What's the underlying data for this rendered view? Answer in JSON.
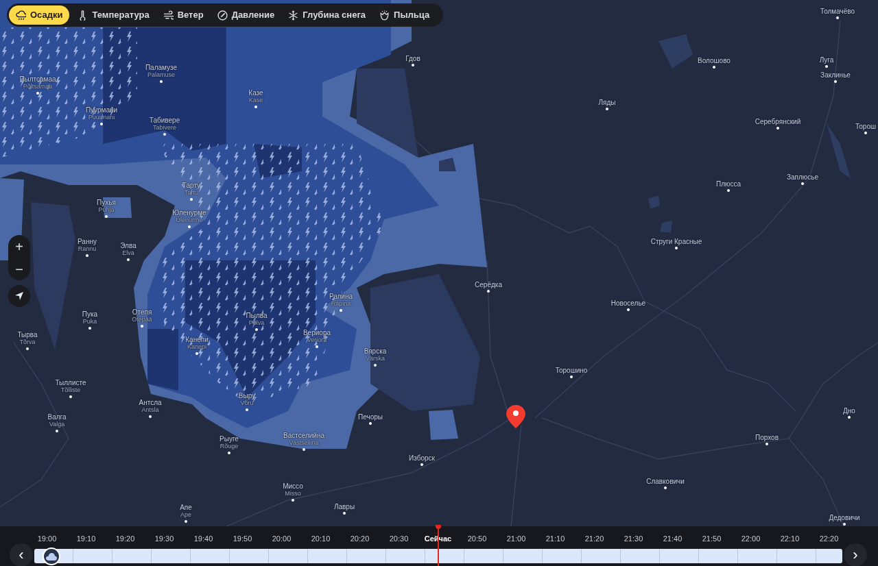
{
  "layers": [
    {
      "label": "Осадки",
      "selected": true
    },
    {
      "label": "Температура",
      "selected": false
    },
    {
      "label": "Ветер",
      "selected": false
    },
    {
      "label": "Давление",
      "selected": false
    },
    {
      "label": "Глубина снега",
      "selected": false
    },
    {
      "label": "Пыльца",
      "selected": false
    }
  ],
  "map": {
    "zoom_in": "+",
    "zoom_out": "−",
    "places": [
      {
        "name": "Паламузе",
        "latin": "Palamuse"
      },
      {
        "name": "Пылтсамаа",
        "latin": "Põltsamaa"
      },
      {
        "name": "Пуурмани",
        "latin": "Puurmani"
      },
      {
        "name": "Табивере",
        "latin": "Tabivere"
      },
      {
        "name": "Казе",
        "latin": "Kase"
      },
      {
        "name": "Гдов"
      },
      {
        "name": "Тарту",
        "latin": "Tartu"
      },
      {
        "name": "Пухья",
        "latin": "Puhja"
      },
      {
        "name": "Юленурме",
        "latin": "Ülenurme"
      },
      {
        "name": "Ранну",
        "latin": "Rannu"
      },
      {
        "name": "Элва",
        "latin": "Elva"
      },
      {
        "name": "Пука",
        "latin": "Puka"
      },
      {
        "name": "Отепя",
        "latin": "Otepää"
      },
      {
        "name": "Пылва",
        "latin": "Põlva"
      },
      {
        "name": "Рапина",
        "latin": "Räpina"
      },
      {
        "name": "Тырва",
        "latin": "Tõrva"
      },
      {
        "name": "Канепи",
        "latin": "Kanepi"
      },
      {
        "name": "Вериора",
        "latin": "Veriora"
      },
      {
        "name": "Вярска",
        "latin": "Värska"
      },
      {
        "name": "Тыллисте",
        "latin": "Tõlliste"
      },
      {
        "name": "Антсла",
        "latin": "Antsla"
      },
      {
        "name": "Выру",
        "latin": "Võru"
      },
      {
        "name": "Печоры"
      },
      {
        "name": "Валга",
        "latin": "Valga"
      },
      {
        "name": "Рыуге",
        "latin": "Rõuge"
      },
      {
        "name": "Вастселийна",
        "latin": "Vastseliina"
      },
      {
        "name": "Изборск"
      },
      {
        "name": "Миссо",
        "latin": "Misso"
      },
      {
        "name": "Лавры"
      },
      {
        "name": "Апе",
        "latin": "Ape"
      },
      {
        "name": "Толмачёво"
      },
      {
        "name": "Волошово"
      },
      {
        "name": "Луга"
      },
      {
        "name": "Заклинье"
      },
      {
        "name": "Ляды"
      },
      {
        "name": "Серебрянский"
      },
      {
        "name": "Торош"
      },
      {
        "name": "Заплюсье"
      },
      {
        "name": "Плюсса"
      },
      {
        "name": "Струги Красные"
      },
      {
        "name": "Серёдка"
      },
      {
        "name": "Новоселье"
      },
      {
        "name": "Торошино"
      },
      {
        "name": "Дно"
      },
      {
        "name": "Порхов"
      },
      {
        "name": "Славковичи"
      },
      {
        "name": "Дедовичи"
      }
    ]
  },
  "timeline": {
    "prev": "‹",
    "next": "›",
    "times": [
      {
        "label": "19:00",
        "selected": false
      },
      {
        "label": "19:10",
        "selected": false
      },
      {
        "label": "19:20",
        "selected": false
      },
      {
        "label": "19:30",
        "selected": false
      },
      {
        "label": "19:40",
        "selected": false
      },
      {
        "label": "19:50",
        "selected": false
      },
      {
        "label": "20:00",
        "selected": false
      },
      {
        "label": "20:10",
        "selected": false
      },
      {
        "label": "20:20",
        "selected": false
      },
      {
        "label": "20:30",
        "selected": false
      },
      {
        "label": "Сейчас",
        "selected": true
      },
      {
        "label": "20:50",
        "selected": false
      },
      {
        "label": "21:00",
        "selected": false
      },
      {
        "label": "21:10",
        "selected": false
      },
      {
        "label": "21:20",
        "selected": false
      },
      {
        "label": "21:30",
        "selected": false
      },
      {
        "label": "21:40",
        "selected": false
      },
      {
        "label": "21:50",
        "selected": false
      },
      {
        "label": "22:00",
        "selected": false
      },
      {
        "label": "22:10",
        "selected": false
      },
      {
        "label": "22:20",
        "selected": false
      }
    ]
  }
}
